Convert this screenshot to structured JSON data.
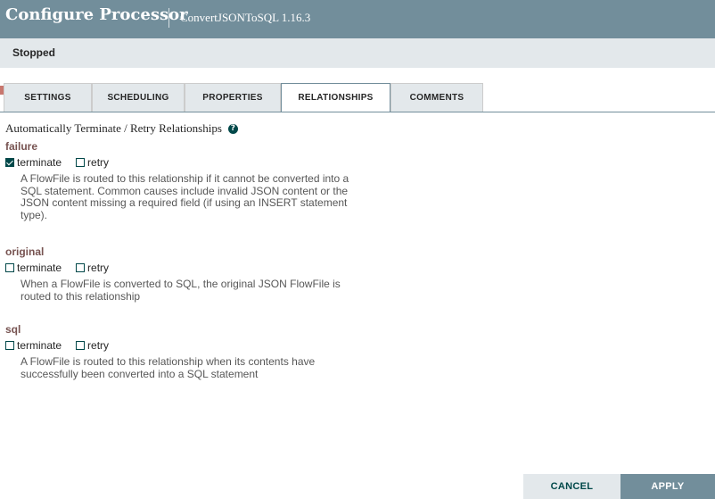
{
  "dialog": {
    "title": "Configure Processor",
    "subtitle": "ConvertJSONToSQL 1.16.3"
  },
  "status": {
    "text": "Stopped",
    "color": "#ba554a"
  },
  "tabs": [
    {
      "label": "SETTINGS"
    },
    {
      "label": "SCHEDULING"
    },
    {
      "label": "PROPERTIES"
    },
    {
      "label": "RELATIONSHIPS",
      "active": true
    },
    {
      "label": "COMMENTS"
    }
  ],
  "relationships": {
    "heading": "Automatically Terminate / Retry Relationships",
    "help_icon": "question-circle-icon",
    "items": [
      {
        "name": "failure",
        "terminate_label": "terminate",
        "retry_label": "retry",
        "terminate_checked": true,
        "retry_checked": false,
        "description": "A FlowFile is routed to this relationship if it cannot be converted into a SQL statement. Common causes include invalid JSON content or the JSON content missing a required field (if using an INSERT statement type)."
      },
      {
        "name": "original",
        "terminate_label": "terminate",
        "retry_label": "retry",
        "terminate_checked": false,
        "retry_checked": false,
        "description": "When a FlowFile is converted to SQL, the original JSON FlowFile is routed to this relationship"
      },
      {
        "name": "sql",
        "terminate_label": "terminate",
        "retry_label": "retry",
        "terminate_checked": false,
        "retry_checked": false,
        "description": "A FlowFile is routed to this relationship when its contents have successfully been converted into a SQL statement"
      }
    ]
  },
  "buttons": {
    "cancel": "CANCEL",
    "apply": "APPLY"
  },
  "colors": {
    "header": "#728e9b",
    "accent": "#004849",
    "relationship_name": "#775351"
  }
}
